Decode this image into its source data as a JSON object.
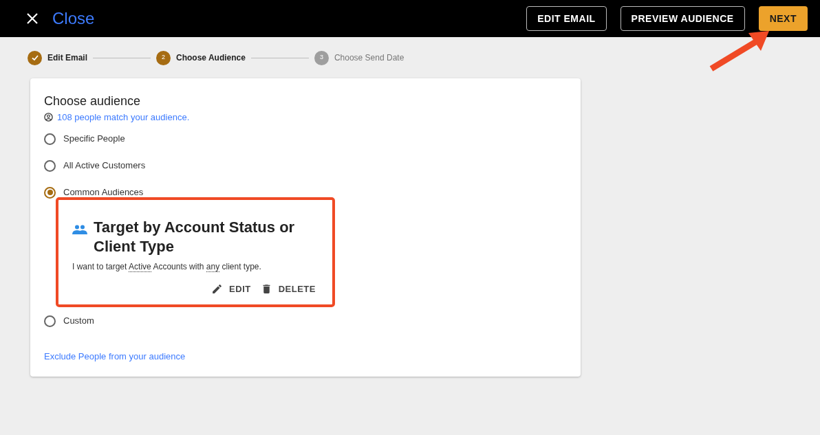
{
  "header": {
    "close_label": "Close",
    "buttons": [
      {
        "label": "EDIT EMAIL",
        "kind": "outline"
      },
      {
        "label": "PREVIEW AUDIENCE",
        "kind": "outline"
      },
      {
        "label": "NEXT",
        "kind": "primary"
      }
    ]
  },
  "steps": [
    {
      "label": "Edit Email",
      "completed": true,
      "selected": false
    },
    {
      "number": "2",
      "label": "Choose Audience",
      "completed": false,
      "selected": true
    },
    {
      "number": "3",
      "label": "Choose Send Date",
      "completed": false,
      "selected": false
    }
  ],
  "card": {
    "title": "Choose audience",
    "match_link": "108 people match your audience.",
    "options": [
      {
        "label": "Specific People",
        "selected": false
      },
      {
        "label": "All Active Customers",
        "selected": false
      },
      {
        "label": "Common Audiences",
        "selected": true
      },
      {
        "label": "Custom",
        "selected": false
      }
    ],
    "audience_card": {
      "title": "Target by Account Status or Client Type",
      "description": [
        {
          "text": "I want to target ",
          "kind": "plain"
        },
        {
          "text": "Active",
          "kind": "choice"
        },
        {
          "text": " Accounts with ",
          "kind": "plain"
        },
        {
          "text": "any",
          "kind": "choice"
        },
        {
          "text": " client type.",
          "kind": "plain"
        }
      ],
      "actions": [
        {
          "label": "EDIT",
          "kind": "edit"
        },
        {
          "label": "DELETE",
          "kind": "delete"
        }
      ]
    },
    "exclude_link": "Exclude People from your audience"
  }
}
